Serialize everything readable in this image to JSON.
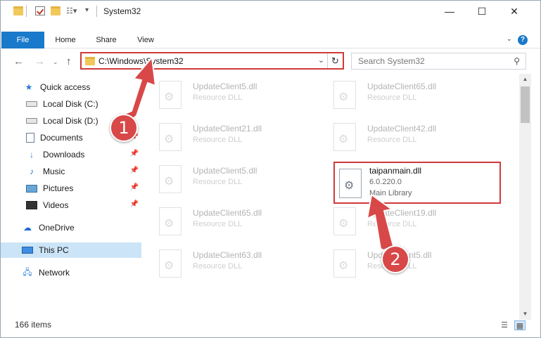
{
  "window": {
    "title": "System32",
    "controls": {
      "minimize": "—",
      "maximize": "☐",
      "close": "✕"
    }
  },
  "ribbon": {
    "tabs": [
      "File",
      "Home",
      "Share",
      "View"
    ],
    "help": "?"
  },
  "address": {
    "path": "C:\\Windows\\System32",
    "search_placeholder": "Search System32"
  },
  "sidebar": {
    "items": [
      {
        "label": "Quick access",
        "icon": "star-icon"
      },
      {
        "label": "Local Disk (C:)",
        "icon": "drive-icon"
      },
      {
        "label": "Local Disk (D:)",
        "icon": "drive-icon"
      },
      {
        "label": "Documents",
        "icon": "documents-icon",
        "pinned": true
      },
      {
        "label": "Downloads",
        "icon": "download-icon",
        "pinned": true
      },
      {
        "label": "Music",
        "icon": "music-icon",
        "pinned": true
      },
      {
        "label": "Pictures",
        "icon": "pictures-icon",
        "pinned": true
      },
      {
        "label": "Videos",
        "icon": "videos-icon",
        "pinned": true
      },
      {
        "label": "OneDrive",
        "icon": "cloud-icon"
      },
      {
        "label": "This PC",
        "icon": "computer-icon",
        "selected": true
      },
      {
        "label": "Network",
        "icon": "network-icon"
      }
    ]
  },
  "files": {
    "faded": [
      {
        "name": "UpdateClient5.dll",
        "type": "Resource DLL"
      },
      {
        "name": "UpdateClient65.dll",
        "type": "Resource DLL"
      },
      {
        "name": "UpdateClient21.dll",
        "type": "Resource DLL"
      },
      {
        "name": "UpdateClient42.dll",
        "type": "Resource DLL"
      },
      {
        "name": "UpdateClient5.dll",
        "type": "Resource DLL"
      },
      {
        "name": "UpdateClient65.dll",
        "type": "Resource DLL"
      },
      {
        "name": "UpdateClient19.dll",
        "type": "Resource DLL"
      },
      {
        "name": "UpdateClient63.dll",
        "type": "Resource DLL"
      },
      {
        "name": "UpdateClient5.dll",
        "type": "Resource DLL"
      }
    ],
    "highlighted": {
      "name": "taipanmain.dll",
      "version": "6.0.220.0",
      "type": "Main Library"
    }
  },
  "status": {
    "item_count": "166 items"
  },
  "annotations": {
    "badge1": "1",
    "badge2": "2",
    "color": "#d84848"
  }
}
